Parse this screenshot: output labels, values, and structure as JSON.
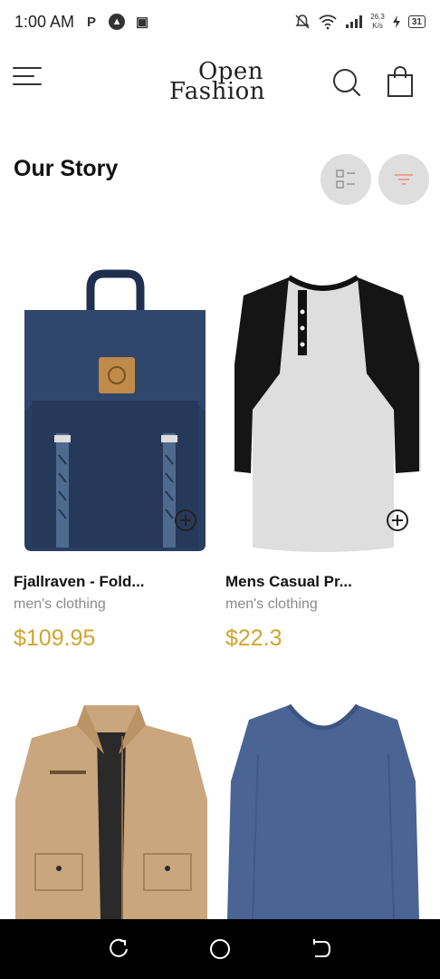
{
  "status_bar": {
    "time": "1:00 AM",
    "icons": [
      "parking-p-icon",
      "navigation-icon",
      "notification-icon"
    ],
    "net_speed_value": "26.3",
    "net_speed_unit": "K/s",
    "battery": "31"
  },
  "header": {
    "logo_line1": "Open",
    "logo_line2": "Fashion"
  },
  "section": {
    "title": "Our Story"
  },
  "products": [
    {
      "title": "Fjallraven - Fold...",
      "category": "men's clothing",
      "price": "$109.95",
      "image": "backpack"
    },
    {
      "title": "Mens Casual Pr...",
      "category": "men's clothing",
      "price": "$22.3",
      "image": "raglan-tshirt"
    },
    {
      "title": "",
      "category": "",
      "price": "",
      "image": "cotton-jacket"
    },
    {
      "title": "",
      "category": "",
      "price": "",
      "image": "slim-fit-tshirt"
    }
  ],
  "colors": {
    "accent_price": "#cfa52e",
    "filter_icon": "#f0a090",
    "toggle_bg": "#dedede"
  }
}
